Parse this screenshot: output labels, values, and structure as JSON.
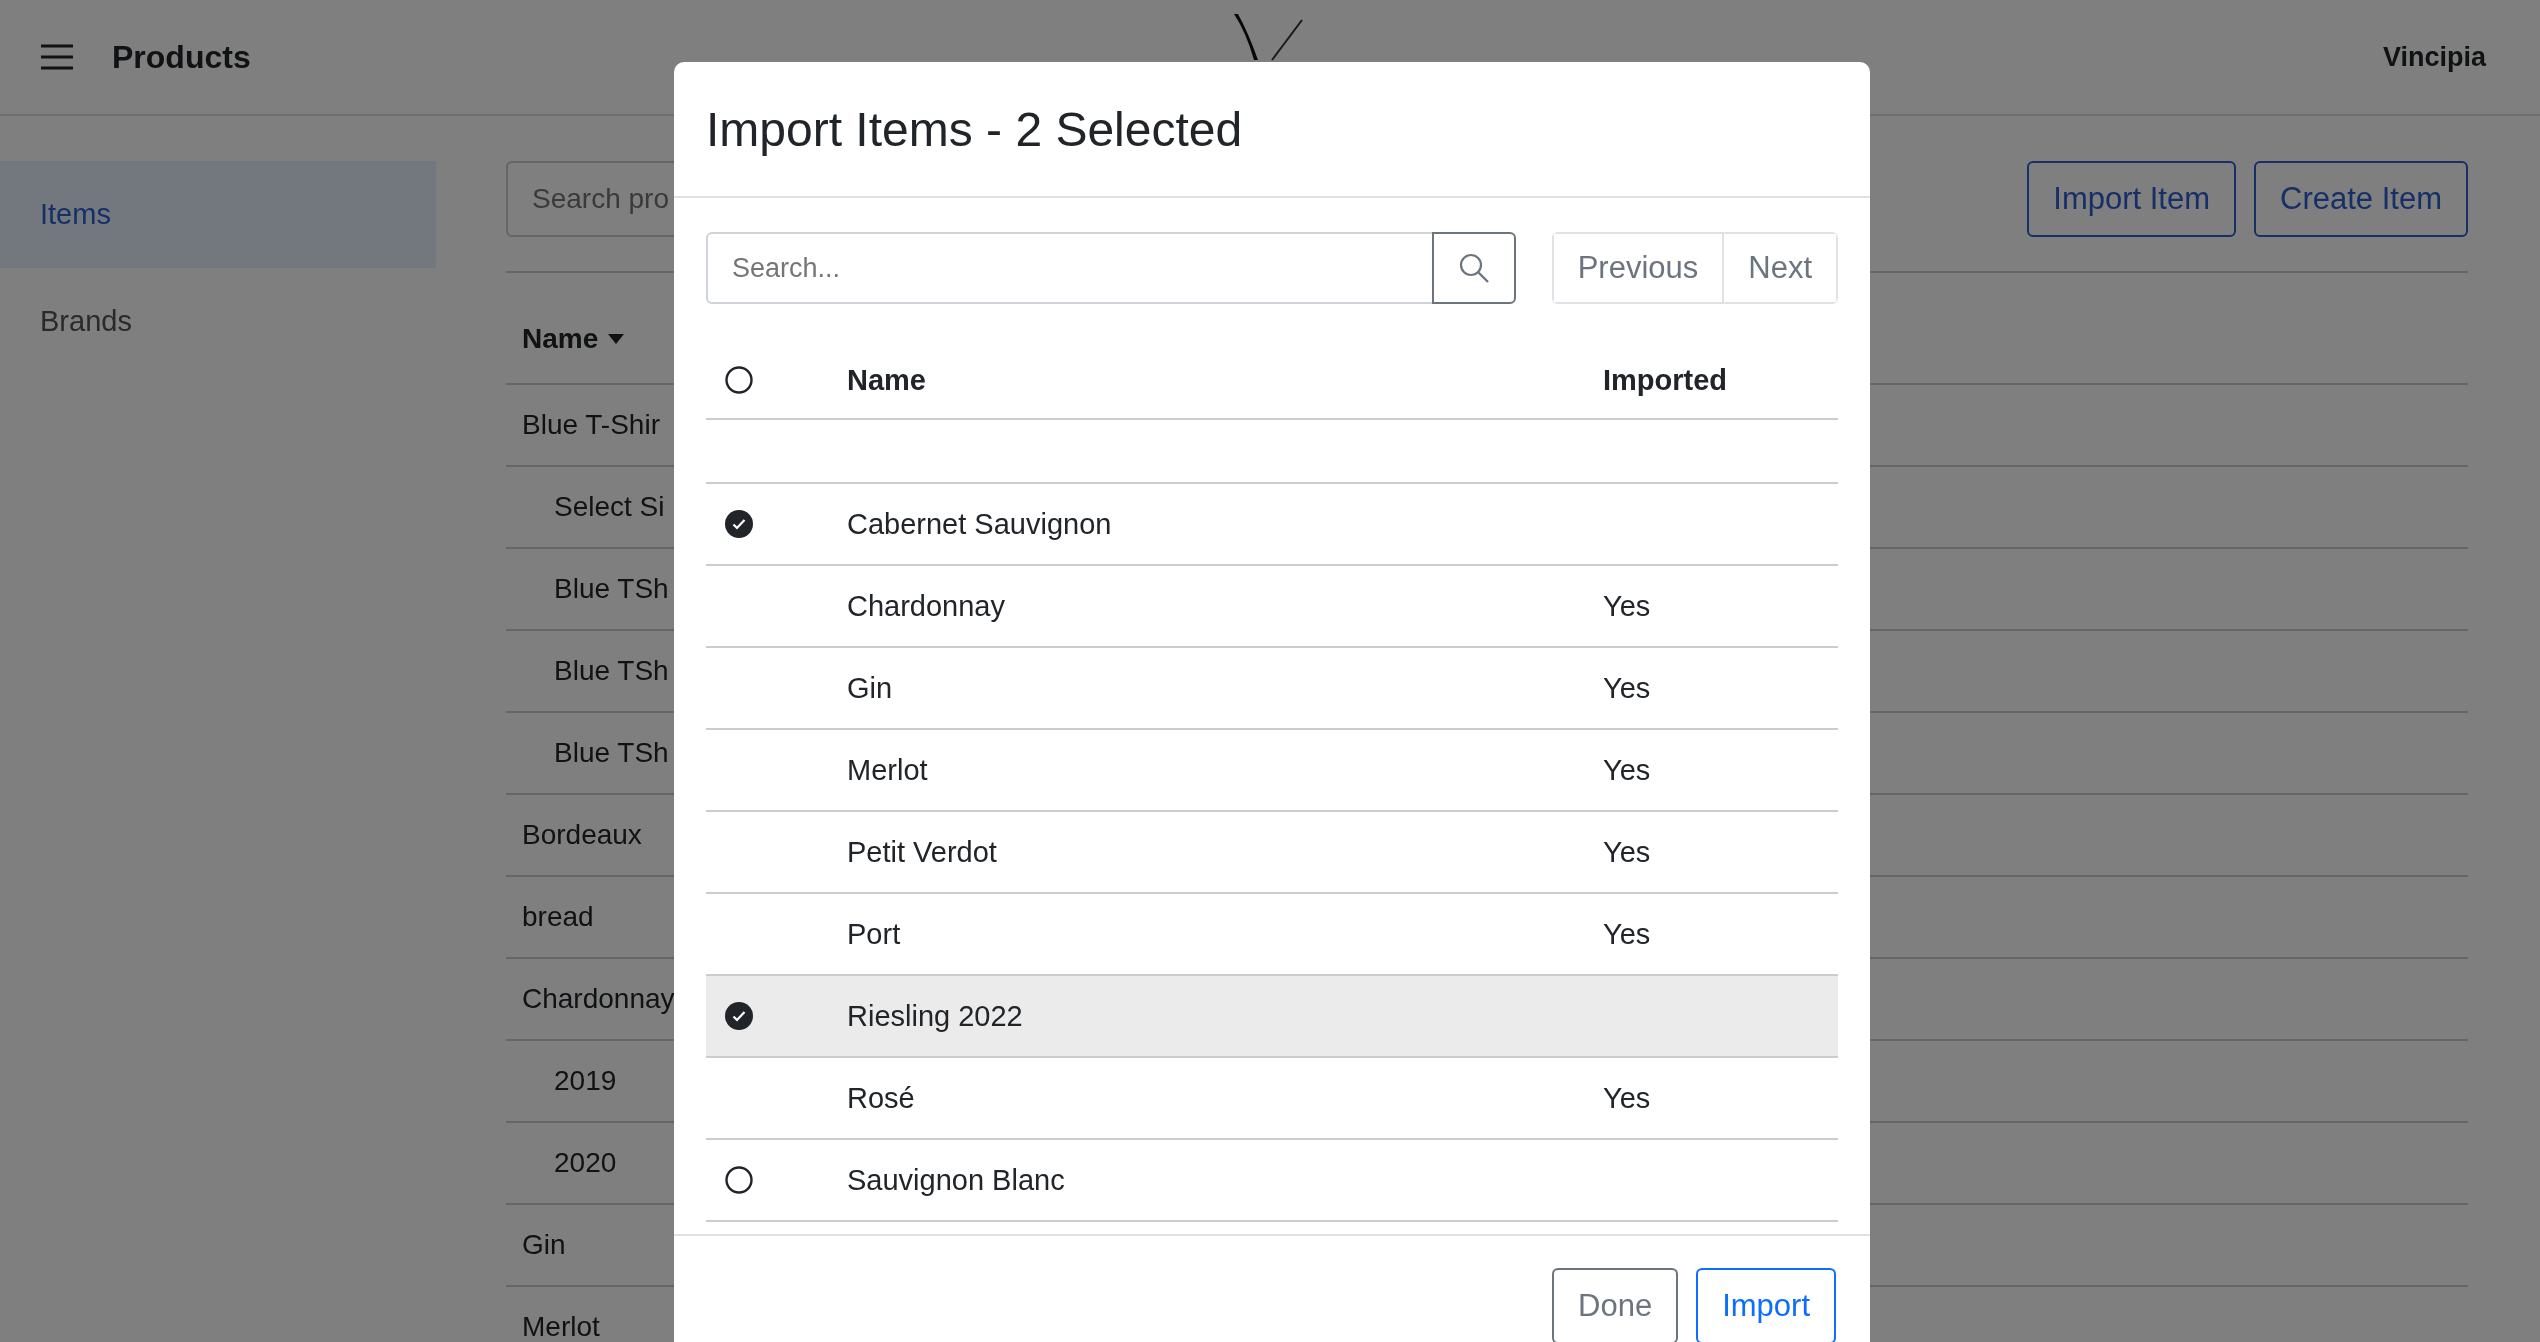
{
  "header": {
    "title": "Products",
    "account": "Vincipia"
  },
  "sidebar": {
    "items": [
      {
        "label": "Items",
        "selected": true
      },
      {
        "label": "Brands",
        "selected": false
      }
    ]
  },
  "toolbar": {
    "search": {
      "placeholder": "Search pro"
    },
    "buttons": [
      "Import Item",
      "Create Item"
    ]
  },
  "table": {
    "columns": [
      {
        "label": "Name",
        "sorted": true
      }
    ],
    "rows": [
      {
        "name": "Blue T-Shir",
        "children": [
          {
            "name": "Select Si"
          },
          {
            "name": "Blue TSh"
          },
          {
            "name": "Blue TSh"
          },
          {
            "name": "Blue TSh"
          }
        ]
      },
      {
        "name": "Bordeaux"
      },
      {
        "name": "bread"
      },
      {
        "name": "Chardonnay",
        "children": [
          {
            "name": "2019"
          },
          {
            "name": "2020"
          }
        ]
      },
      {
        "name": "Gin"
      },
      {
        "name": "Merlot"
      }
    ]
  },
  "modal": {
    "title": "Import Items - 2 Selected",
    "search": {
      "placeholder": "Search..."
    },
    "pager": [
      "Previous",
      "Next"
    ],
    "columns": [
      "Name",
      "Imported"
    ],
    "select_all": false,
    "rows": [
      {
        "kind": "selectable",
        "name": "Cabernet Sauvignon",
        "selected": true,
        "highlighted": false
      },
      {
        "kind": "imported",
        "name": "Chardonnay",
        "imported": "Yes",
        "highlighted": false
      },
      {
        "kind": "imported",
        "name": "Gin",
        "imported": "Yes",
        "highlighted": false
      },
      {
        "kind": "imported",
        "name": "Merlot",
        "imported": "Yes",
        "highlighted": false
      },
      {
        "kind": "imported",
        "name": "Petit Verdot",
        "imported": "Yes",
        "highlighted": false
      },
      {
        "kind": "imported",
        "name": "Port",
        "imported": "Yes",
        "highlighted": false
      },
      {
        "kind": "selectable",
        "name": "Riesling 2022",
        "selected": true,
        "highlighted": true
      },
      {
        "kind": "imported",
        "name": "Rosé",
        "imported": "Yes",
        "highlighted": false
      },
      {
        "kind": "selectable",
        "name": "Sauvignon Blanc",
        "selected": false,
        "highlighted": false
      }
    ],
    "buttons": [
      {
        "label": "Done",
        "kind": "secondary"
      },
      {
        "label": "Import",
        "kind": "primary"
      }
    ]
  }
}
